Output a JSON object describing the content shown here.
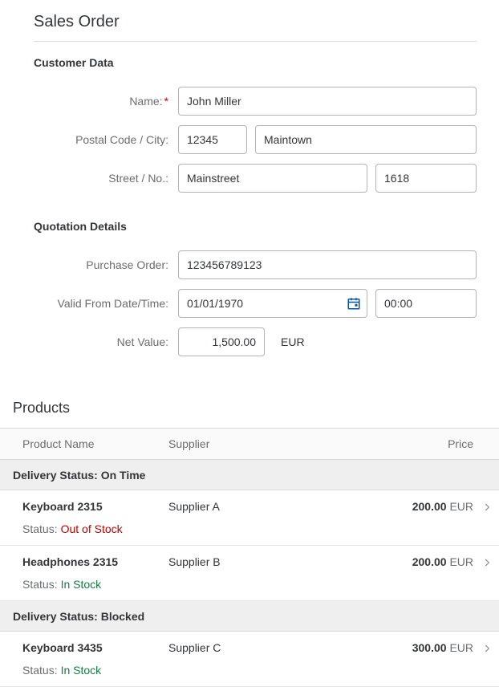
{
  "title": "Sales Order",
  "sections": {
    "customer": {
      "heading": "Customer Data",
      "name_label": "Name:",
      "name_value": "John Miller",
      "postal_label": "Postal Code / City:",
      "postal_value": "12345",
      "city_value": "Maintown",
      "street_label": "Street / No.:",
      "street_value": "Mainstreet",
      "streetno_value": "1618"
    },
    "quotation": {
      "heading": "Quotation Details",
      "po_label": "Purchase Order:",
      "po_value": "123456789123",
      "valid_label": "Valid From Date/Time:",
      "date_value": "01/01/1970",
      "time_value": "00:00",
      "net_label": "Net Value:",
      "net_value": "1,500.00",
      "net_currency": "EUR"
    }
  },
  "products": {
    "title": "Products",
    "columns": {
      "name": "Product Name",
      "supplier": "Supplier",
      "price": "Price"
    },
    "status_label": "Status:",
    "groups": [
      {
        "group_label": "Delivery Status: On Time",
        "rows": [
          {
            "name": "Keyboard 2315",
            "supplier": "Supplier A",
            "price_num": "200.00",
            "price_cur": "EUR",
            "status": "Out of Stock",
            "status_color": "red"
          },
          {
            "name": "Headphones 2315",
            "supplier": "Supplier B",
            "price_num": "200.00",
            "price_cur": "EUR",
            "status": "In Stock",
            "status_color": "green"
          }
        ]
      },
      {
        "group_label": "Delivery Status: Blocked",
        "rows": [
          {
            "name": "Keyboard 3435",
            "supplier": "Supplier C",
            "price_num": "300.00",
            "price_cur": "EUR",
            "status": "In Stock",
            "status_color": "green"
          }
        ]
      }
    ]
  }
}
